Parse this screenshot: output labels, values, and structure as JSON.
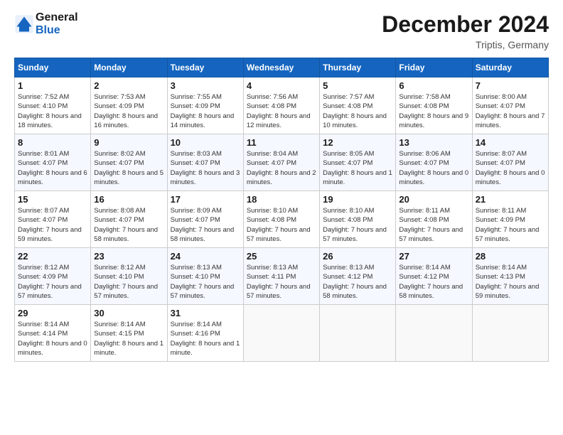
{
  "header": {
    "logo_line1": "General",
    "logo_line2": "Blue",
    "month": "December 2024",
    "location": "Triptis, Germany"
  },
  "weekdays": [
    "Sunday",
    "Monday",
    "Tuesday",
    "Wednesday",
    "Thursday",
    "Friday",
    "Saturday"
  ],
  "weeks": [
    [
      {
        "date": "1",
        "sunrise": "7:52 AM",
        "sunset": "4:10 PM",
        "daylight": "8 hours and 18 minutes."
      },
      {
        "date": "2",
        "sunrise": "7:53 AM",
        "sunset": "4:09 PM",
        "daylight": "8 hours and 16 minutes."
      },
      {
        "date": "3",
        "sunrise": "7:55 AM",
        "sunset": "4:09 PM",
        "daylight": "8 hours and 14 minutes."
      },
      {
        "date": "4",
        "sunrise": "7:56 AM",
        "sunset": "4:08 PM",
        "daylight": "8 hours and 12 minutes."
      },
      {
        "date": "5",
        "sunrise": "7:57 AM",
        "sunset": "4:08 PM",
        "daylight": "8 hours and 10 minutes."
      },
      {
        "date": "6",
        "sunrise": "7:58 AM",
        "sunset": "4:08 PM",
        "daylight": "8 hours and 9 minutes."
      },
      {
        "date": "7",
        "sunrise": "8:00 AM",
        "sunset": "4:07 PM",
        "daylight": "8 hours and 7 minutes."
      }
    ],
    [
      {
        "date": "8",
        "sunrise": "8:01 AM",
        "sunset": "4:07 PM",
        "daylight": "8 hours and 6 minutes."
      },
      {
        "date": "9",
        "sunrise": "8:02 AM",
        "sunset": "4:07 PM",
        "daylight": "8 hours and 5 minutes."
      },
      {
        "date": "10",
        "sunrise": "8:03 AM",
        "sunset": "4:07 PM",
        "daylight": "8 hours and 3 minutes."
      },
      {
        "date": "11",
        "sunrise": "8:04 AM",
        "sunset": "4:07 PM",
        "daylight": "8 hours and 2 minutes."
      },
      {
        "date": "12",
        "sunrise": "8:05 AM",
        "sunset": "4:07 PM",
        "daylight": "8 hours and 1 minute."
      },
      {
        "date": "13",
        "sunrise": "8:06 AM",
        "sunset": "4:07 PM",
        "daylight": "8 hours and 0 minutes."
      },
      {
        "date": "14",
        "sunrise": "8:07 AM",
        "sunset": "4:07 PM",
        "daylight": "8 hours and 0 minutes."
      }
    ],
    [
      {
        "date": "15",
        "sunrise": "8:07 AM",
        "sunset": "4:07 PM",
        "daylight": "7 hours and 59 minutes."
      },
      {
        "date": "16",
        "sunrise": "8:08 AM",
        "sunset": "4:07 PM",
        "daylight": "7 hours and 58 minutes."
      },
      {
        "date": "17",
        "sunrise": "8:09 AM",
        "sunset": "4:07 PM",
        "daylight": "7 hours and 58 minutes."
      },
      {
        "date": "18",
        "sunrise": "8:10 AM",
        "sunset": "4:08 PM",
        "daylight": "7 hours and 57 minutes."
      },
      {
        "date": "19",
        "sunrise": "8:10 AM",
        "sunset": "4:08 PM",
        "daylight": "7 hours and 57 minutes."
      },
      {
        "date": "20",
        "sunrise": "8:11 AM",
        "sunset": "4:08 PM",
        "daylight": "7 hours and 57 minutes."
      },
      {
        "date": "21",
        "sunrise": "8:11 AM",
        "sunset": "4:09 PM",
        "daylight": "7 hours and 57 minutes."
      }
    ],
    [
      {
        "date": "22",
        "sunrise": "8:12 AM",
        "sunset": "4:09 PM",
        "daylight": "7 hours and 57 minutes."
      },
      {
        "date": "23",
        "sunrise": "8:12 AM",
        "sunset": "4:10 PM",
        "daylight": "7 hours and 57 minutes."
      },
      {
        "date": "24",
        "sunrise": "8:13 AM",
        "sunset": "4:10 PM",
        "daylight": "7 hours and 57 minutes."
      },
      {
        "date": "25",
        "sunrise": "8:13 AM",
        "sunset": "4:11 PM",
        "daylight": "7 hours and 57 minutes."
      },
      {
        "date": "26",
        "sunrise": "8:13 AM",
        "sunset": "4:12 PM",
        "daylight": "7 hours and 58 minutes."
      },
      {
        "date": "27",
        "sunrise": "8:14 AM",
        "sunset": "4:12 PM",
        "daylight": "7 hours and 58 minutes."
      },
      {
        "date": "28",
        "sunrise": "8:14 AM",
        "sunset": "4:13 PM",
        "daylight": "7 hours and 59 minutes."
      }
    ],
    [
      {
        "date": "29",
        "sunrise": "8:14 AM",
        "sunset": "4:14 PM",
        "daylight": "8 hours and 0 minutes."
      },
      {
        "date": "30",
        "sunrise": "8:14 AM",
        "sunset": "4:15 PM",
        "daylight": "8 hours and 1 minute."
      },
      {
        "date": "31",
        "sunrise": "8:14 AM",
        "sunset": "4:16 PM",
        "daylight": "8 hours and 1 minute."
      },
      null,
      null,
      null,
      null
    ]
  ]
}
